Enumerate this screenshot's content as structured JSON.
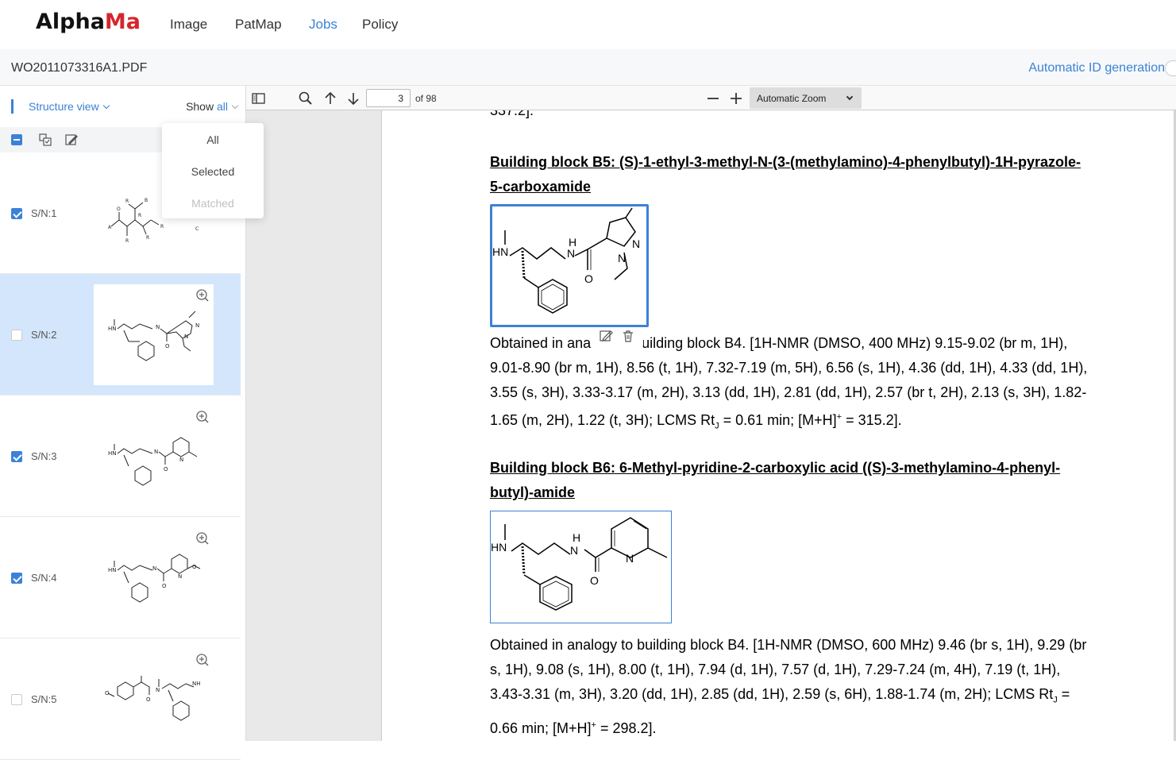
{
  "brand": {
    "logo_part1": "Alpha",
    "logo_part2": "Ma"
  },
  "nav": {
    "items": [
      "Image",
      "PatMap",
      "Jobs",
      "Policy"
    ],
    "active": "Jobs"
  },
  "doc": {
    "filename": "WO2011073316A1.PDF",
    "auto_id_label": "Automatic ID generation"
  },
  "sidebar": {
    "view_label": "Structure view",
    "show_label": "Show",
    "show_value": "all",
    "dropdown": {
      "items": [
        "All",
        "Selected",
        "Matched"
      ]
    },
    "rows": [
      {
        "sn": "S/N:1",
        "checked": true,
        "selected": false
      },
      {
        "sn": "S/N:2",
        "checked": false,
        "selected": true
      },
      {
        "sn": "S/N:3",
        "checked": true,
        "selected": false
      },
      {
        "sn": "S/N:4",
        "checked": true,
        "selected": false
      },
      {
        "sn": "S/N:5",
        "checked": false,
        "selected": false
      }
    ]
  },
  "pdf": {
    "page": "3",
    "page_count": "of 98",
    "zoom": "Automatic Zoom",
    "cut_text": "337.2].",
    "b5_heading": "Building block B5: (S)-1-ethyl-3-methyl-N-(3-(methylamino)-4-phenylbutyl)-1H-pyrazole-5-carboxamide",
    "b5_text_1": "Obtained in ana",
    "b5_text_2": "uilding block B4. [1H-NMR (DMSO, 400 MHz) 9.15-9.02 (br m, 1H), 9.01-8.90 (br m, 1H), 8.56 (t, 1H), 7.32-7.19 (m, 5H), 6.56 (s, 1H), 4.36 (dd, 1H), 4.33 (dd, 1H), 3.55 (s, 3H), 3.33-3.17 (m, 2H), 3.13 (dd, 1H), 2.81 (dd, 1H), 2.57 (br t, 2H), 2.13 (s, 3H), 1.82-1.65 (m, 2H), 1.22 (t, 3H); LCMS Rt",
    "b5_text_3": " = 0.61 min; [M+H]",
    "b5_text_4": " = 315.2].",
    "b6_heading": "Building block B6: 6-Methyl-pyridine-2-carboxylic acid ((S)-3-methylamino-4-phenyl-butyl)-amide",
    "b6_text_1": "Obtained in analogy to building block B4. [1H-NMR (DMSO, 600 MHz) 9.46 (br s, 1H), 9.29 (br s, 1H), 9.08 (s, 1H), 8.00 (t, 1H), 7.94 (d, 1H), 7.57 (d, 1H), 7.29-7.24 (m, 4H), 7.19 (t, 1H), 3.43-3.31 (m, 3H), 3.20 (dd, 1H), 2.85 (dd, 1H), 2.59 (s, 6H), 1.88-1.74 (m, 2H); LCMS Rt",
    "b6_text_2": " = 0.66 min; [M+H]",
    "b6_text_3": " = 298.2].",
    "sub_j": "J",
    "sup_plus": "+"
  },
  "icons": [
    "edit-icon",
    "trash-icon",
    "zoom-in-icon",
    "search-icon",
    "arrow-up-icon",
    "arrow-down-icon",
    "sidebar-toggle-icon",
    "minus-icon",
    "plus-icon"
  ],
  "colors": {
    "accent": "#3b82d6",
    "logo_red": "#d6252b",
    "selected_row": "#d3e6fb"
  }
}
